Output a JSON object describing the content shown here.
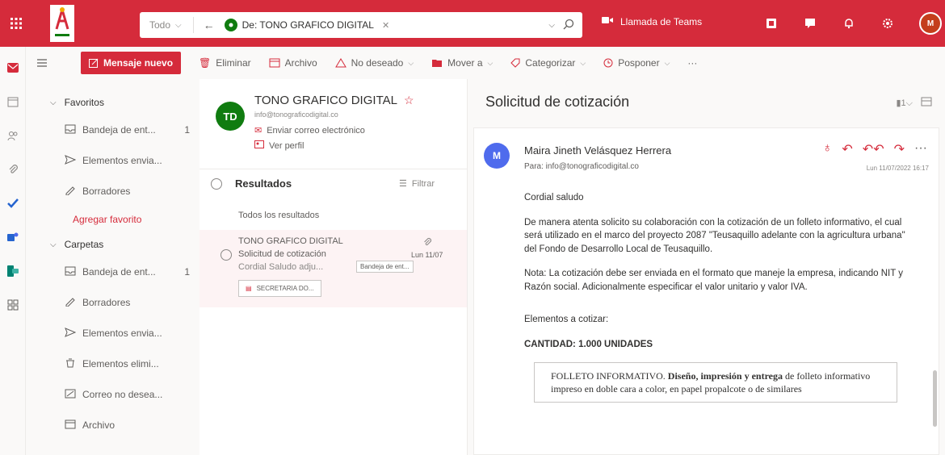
{
  "topbar": {
    "search_scope": "Todo",
    "search_chip": "De: TONO GRAFICO DIGITAL",
    "teams_call": "Llamada de Teams",
    "avatar_initials": "M"
  },
  "commands": {
    "new_message": "Mensaje nuevo",
    "delete": "Eliminar",
    "archive": "Archivo",
    "junk": "No deseado",
    "move_to": "Mover a",
    "categorize": "Categorizar",
    "snooze": "Posponer",
    "more": "···"
  },
  "nav": {
    "favorites": "Favoritos",
    "fav_items": [
      {
        "label": "Bandeja de ent...",
        "count": "1"
      },
      {
        "label": "Elementos envia...",
        "count": ""
      },
      {
        "label": "Borradores",
        "count": ""
      }
    ],
    "add_favorite": "Agregar favorito",
    "folders": "Carpetas",
    "folder_items": [
      {
        "label": "Bandeja de ent...",
        "count": "1"
      },
      {
        "label": "Borradores",
        "count": ""
      },
      {
        "label": "Elementos envia...",
        "count": ""
      },
      {
        "label": "Elementos elimi...",
        "count": ""
      },
      {
        "label": "Correo no desea...",
        "count": ""
      },
      {
        "label": "Archivo",
        "count": ""
      }
    ]
  },
  "contact": {
    "initials": "TD",
    "name": "TONO GRAFICO DIGITAL",
    "email": "info@tonograficodigital.co",
    "send_email": "Enviar correo electrónico",
    "view_profile": "Ver perfil"
  },
  "results": {
    "title": "Resultados",
    "filter": "Filtrar",
    "all": "Todos los resultados"
  },
  "message_item": {
    "from": "TONO GRAFICO DIGITAL",
    "subject": "Solicitud de cotización",
    "preview": "Cordial Saludo adju...",
    "date": "Lun 11/07",
    "folder_tag": "Bandeja de ent...",
    "attachment": "SECRETARIA DO..."
  },
  "reading": {
    "title": "Solicitud de cotización",
    "sender_initial": "M",
    "sender_name": "Maira Jineth Velásquez Herrera",
    "to": "Para: info@tonograficodigital.co",
    "date": "Lun 11/07/2022 16:17",
    "greeting": "Cordial saludo",
    "para1": "De manera atenta solicito su colaboración con la cotización de un folleto informativo, el cual será utilizado en el marco del proyecto 2087 \"Teusaquillo adelante con la agricultura urbana\" del Fondo de Desarrollo Local de Teusaquillo.",
    "para2": "Nota: La cotización debe ser enviada en el formato que maneje la empresa, indicando NIT y Razón social. Adicionalmente especificar el valor unitario y valor IVA.",
    "elements": "Elementos a cotizar:",
    "quantity": "CANTIDAD: 1.000 UNIDADES",
    "table_lead": "FOLLETO INFORMATIVO.",
    "table_bold": "Diseño, impresión y entrega",
    "table_rest": "de folleto informativo impreso en doble cara a color, en papel propalcote o de similares"
  },
  "colors": {
    "brand": "#d52b3b",
    "contact_avatar": "#107c10",
    "sender_avatar": "#4f6bed"
  }
}
